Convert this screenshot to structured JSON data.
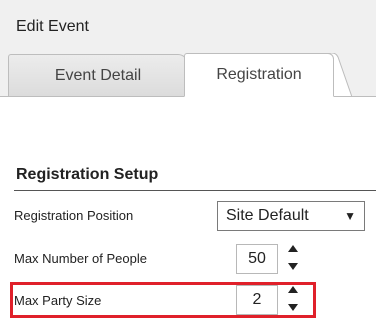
{
  "window": {
    "title": "Edit Event"
  },
  "tabs": [
    {
      "label": "Event Detail",
      "active": false
    },
    {
      "label": "Registration",
      "active": true
    }
  ],
  "section": {
    "title": "Registration Setup"
  },
  "fields": {
    "registration_position": {
      "label": "Registration Position",
      "value": "Site Default",
      "icon": "dropdown-arrow-icon"
    },
    "max_people": {
      "label": "Max Number of People",
      "value": "50"
    },
    "max_party": {
      "label": "Max Party Size",
      "value": "2"
    }
  },
  "colors": {
    "highlight": "#e0202a",
    "tab_strip": "#f0f0f0"
  }
}
